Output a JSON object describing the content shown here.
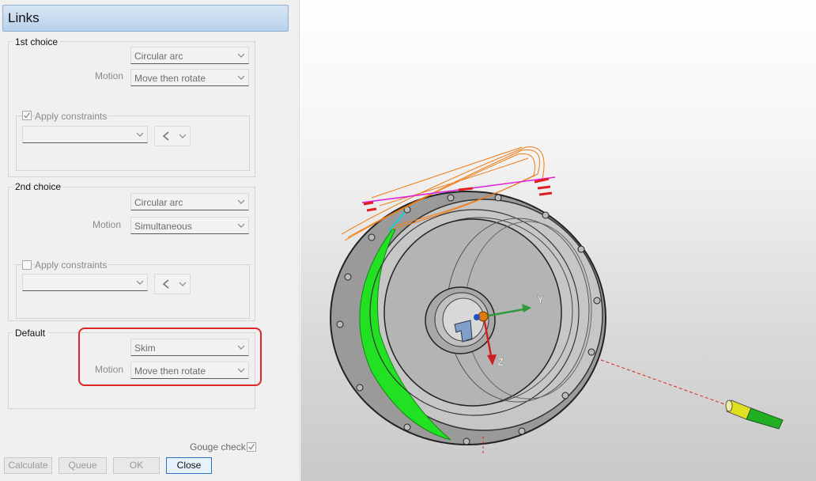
{
  "dialog": {
    "title": "Links",
    "first_choice": {
      "label": "1st choice",
      "link_type": "Circular arc",
      "motion_label": "Motion",
      "motion": "Move then rotate",
      "apply_constraints_label": "Apply constraints",
      "apply_constraints_checked": true
    },
    "second_choice": {
      "label": "2nd choice",
      "link_type": "Circular arc",
      "motion_label": "Motion",
      "motion": "Simultaneous",
      "apply_constraints_label": "Apply constraints",
      "apply_constraints_checked": false
    },
    "default": {
      "label": "Default",
      "link_type": "Skim",
      "motion_label": "Motion",
      "motion": "Move then rotate"
    },
    "gouge_check_label": "Gouge check",
    "gouge_check_checked": true,
    "buttons": {
      "calculate": "Calculate",
      "queue": "Queue",
      "ok": "OK",
      "close": "Close"
    }
  },
  "viewport": {
    "axis_y_label": "Y",
    "axis_z_label": "Z",
    "colors": {
      "highlight": "#e0242a",
      "toolpath_orange": "#f07a14",
      "toolpath_magenta": "#e020e0",
      "surface_green": "#22e022",
      "axis_green": "#2f9a3a",
      "axis_red": "#d02020"
    }
  }
}
